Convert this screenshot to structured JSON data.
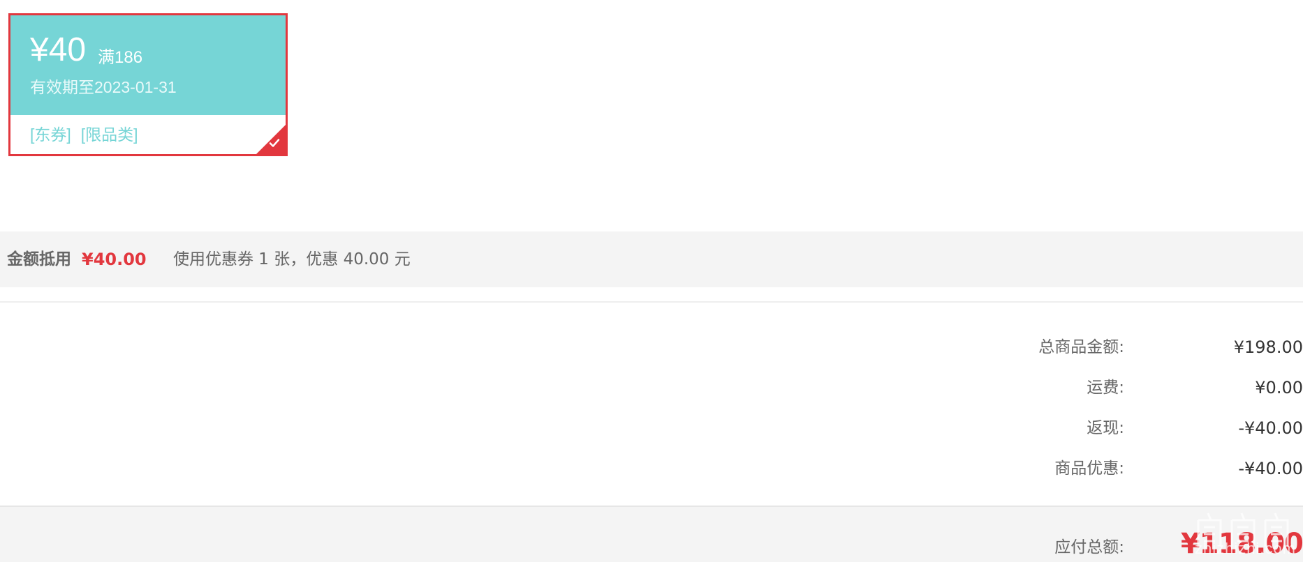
{
  "coupon": {
    "amount": "¥40",
    "threshold": "满186",
    "validity": "有效期至2023-01-31",
    "tags": [
      "[东券]",
      "[限品类]"
    ],
    "selected": true,
    "check_icon": "checkmark-icon"
  },
  "discount": {
    "label": "金额抵用",
    "amount": "¥40.00",
    "note": "使用优惠券 1 张，优惠 40.00 元"
  },
  "summary": {
    "rows": [
      {
        "label": "总商品金额:",
        "value": "¥198.00"
      },
      {
        "label": "运费:",
        "value": "¥0.00"
      },
      {
        "label": "返现:",
        "value": "-¥40.00"
      },
      {
        "label": "商品优惠:",
        "value": "-¥40.00"
      }
    ],
    "total_label": "应付总额:",
    "total_value": "¥118.00"
  },
  "watermark": {
    "text": "zhizhizhi.com"
  },
  "colors": {
    "accent_red": "#e2373e",
    "coupon_teal": "#76d5d6",
    "bar_gray": "#f4f4f4"
  }
}
